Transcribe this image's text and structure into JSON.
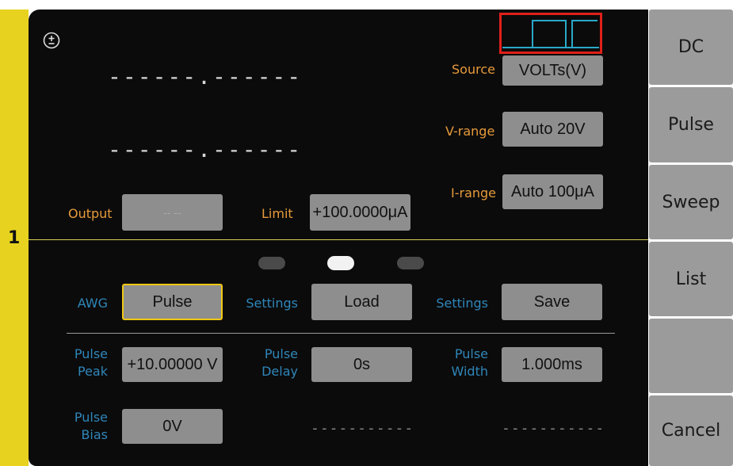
{
  "channel": "1",
  "header": {
    "polarity_icon": "plus-minus-circle-icon",
    "waveform_icon": "pulse-waveform-icon",
    "waveform_highlight_color": "#e0201a"
  },
  "readout": {
    "primary": "------.------",
    "secondary": "------.------"
  },
  "source": {
    "label": "Source",
    "value": "VOLTs(V)"
  },
  "vrange": {
    "label": "V-range",
    "value": "Auto 20V"
  },
  "irange": {
    "label": "I-range",
    "value": "Auto 100μA"
  },
  "output": {
    "label": "Output",
    "value": "-- --"
  },
  "limit": {
    "label": "Limit",
    "value": "+100.0000μA"
  },
  "awg": {
    "label": "AWG",
    "value": "Pulse",
    "load_label": "Settings",
    "load_value": "Load",
    "save_label": "Settings",
    "save_value": "Save"
  },
  "pulse_peak": {
    "label_1": "Pulse",
    "label_2": "Peak",
    "value": "+10.00000 V"
  },
  "pulse_delay": {
    "label_1": "Pulse",
    "label_2": "Delay",
    "value": "0s"
  },
  "pulse_width": {
    "label_1": "Pulse",
    "label_2": "Width",
    "value": "1.000ms"
  },
  "pulse_bias": {
    "label_1": "Pulse",
    "label_2": "Bias",
    "value": "0V"
  },
  "empty_field_1": "-----------",
  "empty_field_2": "-----------",
  "sidebar": {
    "items": [
      {
        "label": "DC"
      },
      {
        "label": "Pulse"
      },
      {
        "label": "Sweep"
      },
      {
        "label": "List"
      },
      {
        "label": ""
      },
      {
        "label": "Cancel"
      }
    ]
  },
  "colors": {
    "accent_label": "#e79a3b",
    "secondary_label": "#2f86b9",
    "selected_border": "#f0c814",
    "channel_strip": "#e6d21f"
  }
}
